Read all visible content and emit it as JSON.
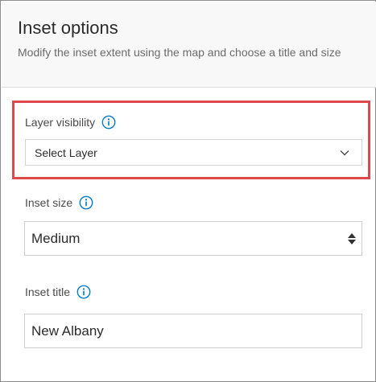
{
  "panel": {
    "title": "Inset options",
    "description": "Modify the inset extent using the map and choose a title and size"
  },
  "layer_visibility": {
    "label": "Layer visibility",
    "selected": "Select Layer",
    "info_icon": "info-icon",
    "chevron_icon": "chevron-down-icon"
  },
  "inset_size": {
    "label": "Inset size",
    "selected": "Medium",
    "info_icon": "info-icon",
    "stepper_icon": "sort-up-down-icon"
  },
  "inset_title": {
    "label": "Inset title",
    "value": "New Albany",
    "info_icon": "info-icon"
  },
  "colors": {
    "accent": "#007ac2",
    "highlight": "#e0474c",
    "header_bg": "#f8f8f8"
  }
}
